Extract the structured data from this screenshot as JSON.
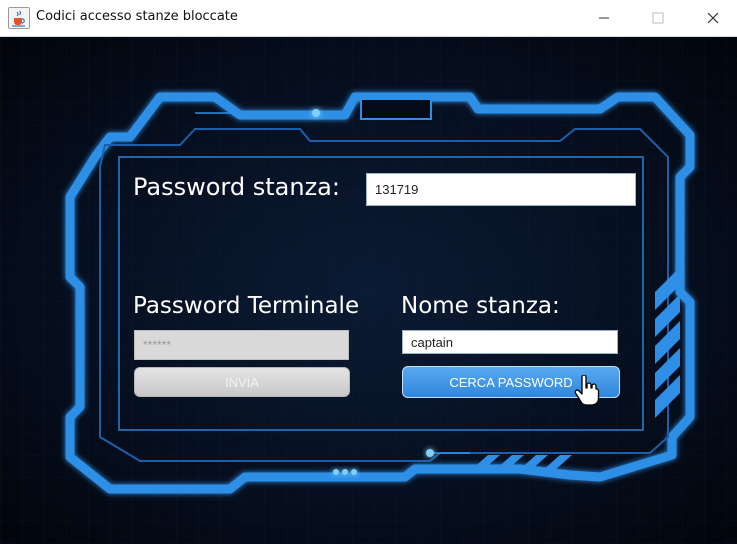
{
  "window": {
    "title": "Codici accesso stanze bloccate",
    "app_icon": "java-coffee-cup-icon"
  },
  "room_password": {
    "label": "Password stanza:",
    "value": "131719"
  },
  "terminal_password": {
    "label": "Password Terminale",
    "masked_value": "******",
    "send_button_label": "INVIA",
    "enabled": false
  },
  "room_name": {
    "label": "Nome stanza:",
    "value": "captain",
    "search_button_label": "CERCA PASSWORD"
  },
  "theme": {
    "accent": "#2f8fe6",
    "background": "#050b18",
    "button_blue": "#3c98ec",
    "disabled_gray": "#d4d4d4"
  }
}
